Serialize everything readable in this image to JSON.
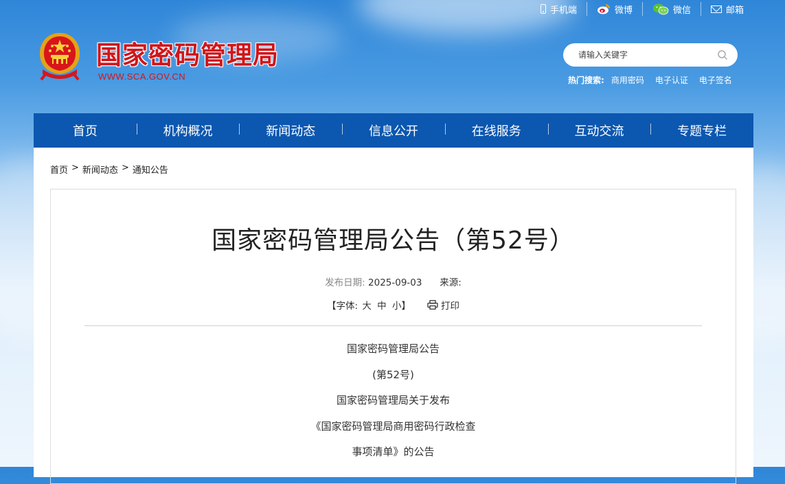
{
  "top_links": {
    "mobile": "手机端",
    "weibo": "微博",
    "wechat": "微信",
    "mail": "邮箱"
  },
  "logo": {
    "name": "国家密码管理局",
    "url": "WWW.SCA.GOV.CN"
  },
  "search": {
    "placeholder": "请输入关键字",
    "hot_label": "热门搜索:",
    "hot_items": [
      "商用密码",
      "电子认证",
      "电子签名"
    ]
  },
  "nav": [
    "首页",
    "机构概况",
    "新闻动态",
    "信息公开",
    "在线服务",
    "互动交流",
    "专题专栏"
  ],
  "breadcrumb": [
    "首页",
    ">",
    "新闻动态",
    ">",
    "通知公告"
  ],
  "article": {
    "title": "国家密码管理局公告（第52号）",
    "date_label": "发布日期:",
    "date": "2025-09-03",
    "source_label": "来源:",
    "font_label": "【字体:",
    "font_large": "大",
    "font_medium": "中",
    "font_small": "小】",
    "print": "打印",
    "lines": [
      "国家密码管理局公告",
      "(第52号)",
      "国家密码管理局关于发布",
      "《国家密码管理局商用密码行政检查",
      "事项清单》的公告"
    ]
  },
  "colors": {
    "nav_bg": "#0c57b0",
    "brand_red": "#d0161b"
  }
}
